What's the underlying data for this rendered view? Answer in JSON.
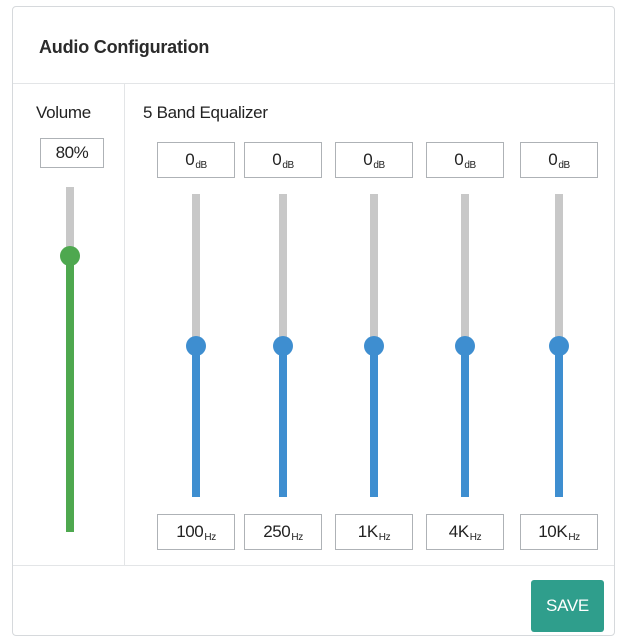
{
  "header": {
    "title": "Audio Configuration"
  },
  "volume": {
    "label": "Volume",
    "value_text": "80%",
    "level": 0.8,
    "color": "#4ea84f"
  },
  "equalizer": {
    "label": "5 Band Equalizer",
    "color": "#3e8ed0",
    "bands": [
      {
        "gain_value": "0",
        "gain_unit": "dB",
        "freq_value": "100",
        "freq_unit": "Hz",
        "level": 0.5
      },
      {
        "gain_value": "0",
        "gain_unit": "dB",
        "freq_value": "250",
        "freq_unit": "Hz",
        "level": 0.5
      },
      {
        "gain_value": "0",
        "gain_unit": "dB",
        "freq_value": "1K",
        "freq_unit": "Hz",
        "level": 0.5
      },
      {
        "gain_value": "0",
        "gain_unit": "dB",
        "freq_value": "4K",
        "freq_unit": "Hz",
        "level": 0.5
      },
      {
        "gain_value": "0",
        "gain_unit": "dB",
        "freq_value": "10K",
        "freq_unit": "Hz",
        "level": 0.5
      }
    ]
  },
  "footer": {
    "save_label": "SAVE"
  }
}
